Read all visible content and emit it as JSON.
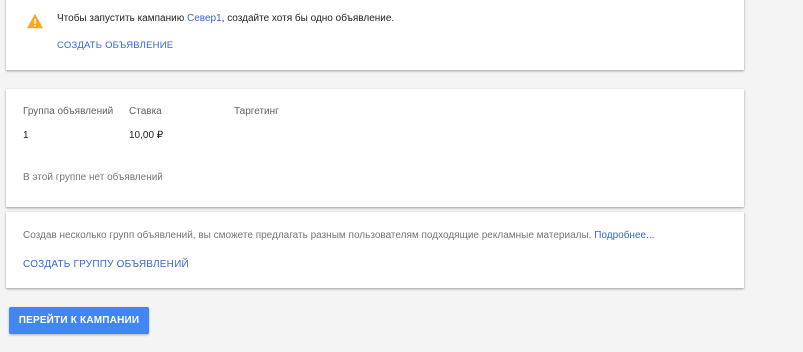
{
  "warning": {
    "icon": "warning-icon",
    "text_before": "Чтобы запустить кампанию ",
    "campaign_name": "Север1",
    "text_after": ", создайте хотя бы одно объявление.",
    "create_ad_label": "СОЗДАТЬ ОБЪЯВЛЕНИЕ",
    "icon_color": "#f9a825"
  },
  "ad_groups": {
    "headers": {
      "group": "Группа объявлений",
      "bid": "Ставка",
      "targeting": "Таргетинг"
    },
    "rows": [
      {
        "group": "1",
        "bid": "10,00 ₽",
        "targeting": ""
      }
    ],
    "empty_text": "В этой группе нет объявлений"
  },
  "info": {
    "text": "Создав несколько групп объявлений, вы сможете предлагать разным пользователям подходящие рекламные материалы. ",
    "more_link": "Подробнее...",
    "create_group_label": "СОЗДАТЬ ГРУППУ ОБЪЯВЛЕНИЙ"
  },
  "actions": {
    "go_to_campaign_label": "ПЕРЕЙТИ К КАМПАНИИ"
  },
  "colors": {
    "link": "#3367d6",
    "primary": "#4285f4",
    "background": "#f4f4f4"
  }
}
